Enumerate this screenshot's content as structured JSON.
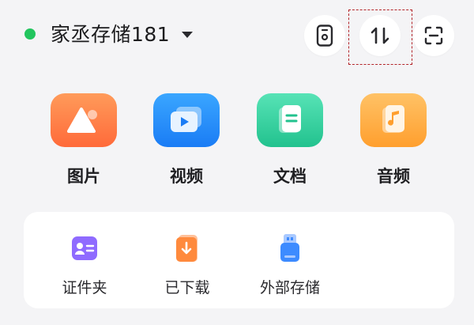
{
  "header": {
    "device_name": "家丞存储181",
    "status_color": "#22c55e",
    "buttons": [
      {
        "icon": "phone-icon"
      },
      {
        "icon": "transfer-icon"
      },
      {
        "icon": "scan-icon"
      }
    ]
  },
  "categories": [
    {
      "label": "图片",
      "icon": "image-icon",
      "color": "#ff7a45"
    },
    {
      "label": "视频",
      "icon": "video-icon",
      "color": "#2a8cff"
    },
    {
      "label": "文档",
      "icon": "document-icon",
      "color": "#2fd29a"
    },
    {
      "label": "音频",
      "icon": "music-icon",
      "color": "#ffad42"
    }
  ],
  "tools": [
    {
      "label": "证件夹",
      "icon": "id-card-icon",
      "color": "#8f6bff"
    },
    {
      "label": "已下载",
      "icon": "download-icon",
      "color": "#ff8a3d"
    },
    {
      "label": "外部存储",
      "icon": "usb-drive-icon",
      "color": "#3d8bff"
    }
  ]
}
